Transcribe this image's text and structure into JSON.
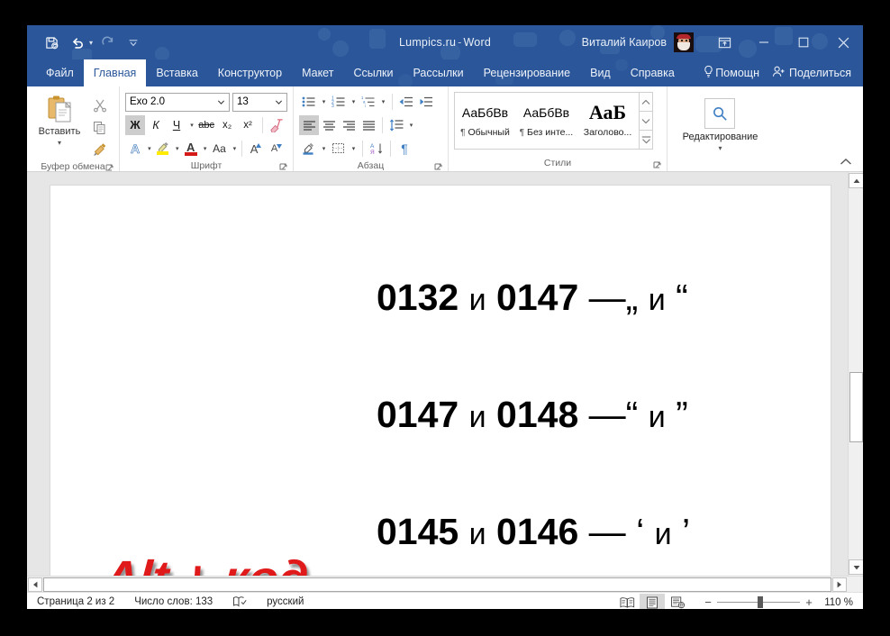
{
  "window": {
    "title": "Lumpics.ru",
    "title_sep": "-",
    "app": "Word",
    "user": "Виталий Каиров",
    "avatar_name": "user-avatar"
  },
  "quick_access": {
    "save": "save-icon",
    "undo": "undo-icon",
    "redo": "redo-icon",
    "customize": "customize-qat-icon"
  },
  "window_controls": {
    "ribbon_display": "ribbon-display-options-icon",
    "minimize": "minimize-icon",
    "maximize": "maximize-icon",
    "close": "close-icon"
  },
  "tabs": [
    {
      "label": "Файл",
      "active": false
    },
    {
      "label": "Главная",
      "active": true
    },
    {
      "label": "Вставка",
      "active": false
    },
    {
      "label": "Конструктор",
      "active": false
    },
    {
      "label": "Макет",
      "active": false
    },
    {
      "label": "Ссылки",
      "active": false
    },
    {
      "label": "Рассылки",
      "active": false
    },
    {
      "label": "Рецензирование",
      "active": false
    },
    {
      "label": "Вид",
      "active": false
    },
    {
      "label": "Справка",
      "active": false
    }
  ],
  "tabs_right": {
    "tellme": "Помощн",
    "share": "Поделиться"
  },
  "ribbon": {
    "clipboard": {
      "group_label": "Буфер обмена",
      "paste_label": "Вставить",
      "cut": "cut-icon",
      "copy": "copy-icon",
      "format_painter": "format-painter-icon"
    },
    "font": {
      "group_label": "Шрифт",
      "font_name": "Exo 2.0",
      "font_size": "13",
      "bold": "Ж",
      "italic": "К",
      "underline": "Ч",
      "strikethrough": "abc",
      "subscript": "x₂",
      "superscript": "x²",
      "clear_formatting": "clear-formatting-icon",
      "text_effects": "A",
      "highlight": "highlight-icon",
      "font_color": "A",
      "change_case": "Aa",
      "grow_font": "A",
      "shrink_font": "A"
    },
    "paragraph": {
      "group_label": "Абзац",
      "bullets": "bullets-icon",
      "numbering": "numbering-icon",
      "multilevel": "multilevel-list-icon",
      "decrease_indent": "decrease-indent-icon",
      "increase_indent": "increase-indent-icon",
      "align_left": "align-left-icon",
      "align_center": "align-center-icon",
      "align_right": "align-right-icon",
      "align_justify": "align-justify-icon",
      "line_spacing": "line-spacing-icon",
      "shading": "shading-icon",
      "borders": "borders-icon",
      "sort": "sort-icon",
      "show_marks": "¶"
    },
    "styles": {
      "group_label": "Стили",
      "items": [
        {
          "sample": "АаБбВв",
          "name": "Обычный",
          "pilcrow": "¶",
          "kind": "normal"
        },
        {
          "sample": "АаБбВв",
          "name": "Без инте...",
          "pilcrow": "¶",
          "kind": "normal"
        },
        {
          "sample": "АаБ",
          "name": "Заголово...",
          "pilcrow": "",
          "kind": "heading"
        }
      ],
      "scroll_up": "scroll-up-icon",
      "scroll_down": "scroll-down-icon",
      "more": "more-styles-icon"
    },
    "editing": {
      "group_label": "Редактирование",
      "icon": "find-search-icon"
    },
    "collapse": "collapse-ribbon-icon"
  },
  "document": {
    "lines": [
      {
        "code1": "0132",
        "conj1": "и",
        "code2": "0147",
        "dash": "—",
        "sym1": "„",
        "conj2": "и",
        "sym2": "“"
      },
      {
        "code1": "0147",
        "conj1": "и",
        "code2": "0148",
        "dash": "—",
        "sym1": "“",
        "conj2": "и",
        "sym2": "”"
      },
      {
        "code1": "0145",
        "conj1": "и",
        "code2": "0146",
        "dash": "—",
        "sym1": "‘",
        "conj2": "и",
        "sym2": "’"
      }
    ],
    "overlay_text": "Alt + код",
    "overlay_color": "#e01a1a"
  },
  "status_bar": {
    "page": "Страница 2 из 2",
    "words": "Число слов: 133",
    "proofing_icon": "proofing-errors-icon",
    "language": "русский",
    "view_read": "read-mode-icon",
    "view_print": "print-layout-icon",
    "view_web": "web-layout-icon",
    "zoom_out": "−",
    "zoom_in": "+",
    "zoom_value": "110 %"
  },
  "colors": {
    "titlebar": "#2b579a",
    "accent": "#2b579a",
    "page_bg": "#e6e6e6",
    "doc_text": "#000000",
    "overlay_red": "#e01a1a"
  }
}
